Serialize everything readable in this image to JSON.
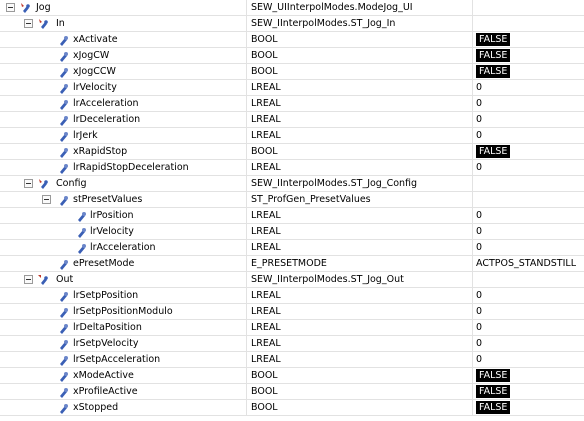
{
  "rows": [
    {
      "name": "Jog",
      "type": "SEW_UIInterpolModes.ModeJog_UI",
      "value": "",
      "is_bool": false,
      "expanded": true,
      "icon": "struct-variable-icon"
    },
    {
      "name": "In",
      "type": "SEW_IInterpolModes.ST_Jog_In",
      "value": "",
      "is_bool": false,
      "expanded": true,
      "icon": "struct-variable-icon"
    },
    {
      "name": "xActivate",
      "type": "BOOL",
      "value": "FALSE",
      "is_bool": true,
      "icon": "variable-icon"
    },
    {
      "name": "xJogCW",
      "type": "BOOL",
      "value": "FALSE",
      "is_bool": true,
      "icon": "variable-icon"
    },
    {
      "name": "xJogCCW",
      "type": "BOOL",
      "value": "FALSE",
      "is_bool": true,
      "icon": "variable-icon"
    },
    {
      "name": "lrVelocity",
      "type": "LREAL",
      "value": "0",
      "is_bool": false,
      "icon": "variable-icon"
    },
    {
      "name": "lrAcceleration",
      "type": "LREAL",
      "value": "0",
      "is_bool": false,
      "icon": "variable-icon"
    },
    {
      "name": "lrDeceleration",
      "type": "LREAL",
      "value": "0",
      "is_bool": false,
      "icon": "variable-icon"
    },
    {
      "name": "lrJerk",
      "type": "LREAL",
      "value": "0",
      "is_bool": false,
      "icon": "variable-icon"
    },
    {
      "name": "xRapidStop",
      "type": "BOOL",
      "value": "FALSE",
      "is_bool": true,
      "icon": "variable-icon"
    },
    {
      "name": "lrRapidStopDeceleration",
      "type": "LREAL",
      "value": "0",
      "is_bool": false,
      "icon": "variable-icon"
    },
    {
      "name": "Config",
      "type": "SEW_IInterpolModes.ST_Jog_Config",
      "value": "",
      "is_bool": false,
      "expanded": true,
      "icon": "struct-variable-icon"
    },
    {
      "name": "stPresetValues",
      "type": "ST_ProfGen_PresetValues",
      "value": "",
      "is_bool": false,
      "expanded": true,
      "icon": "variable-icon"
    },
    {
      "name": "lrPosition",
      "type": "LREAL",
      "value": "0",
      "is_bool": false,
      "icon": "variable-icon"
    },
    {
      "name": "lrVelocity",
      "type": "LREAL",
      "value": "0",
      "is_bool": false,
      "icon": "variable-icon"
    },
    {
      "name": "lrAcceleration",
      "type": "LREAL",
      "value": "0",
      "is_bool": false,
      "icon": "variable-icon"
    },
    {
      "name": "ePresetMode",
      "type": "E_PRESETMODE",
      "value": "ACTPOS_STANDSTILL",
      "is_bool": false,
      "icon": "variable-icon"
    },
    {
      "name": "Out",
      "type": "SEW_IInterpolModes.ST_Jog_Out",
      "value": "",
      "is_bool": false,
      "expanded": true,
      "icon": "output-struct-icon"
    },
    {
      "name": "lrSetpPosition",
      "type": "LREAL",
      "value": "0",
      "is_bool": false,
      "icon": "variable-icon"
    },
    {
      "name": "lrSetpPositionModulo",
      "type": "LREAL",
      "value": "0",
      "is_bool": false,
      "icon": "variable-icon"
    },
    {
      "name": "lrDeltaPosition",
      "type": "LREAL",
      "value": "0",
      "is_bool": false,
      "icon": "variable-icon"
    },
    {
      "name": "lrSetpVelocity",
      "type": "LREAL",
      "value": "0",
      "is_bool": false,
      "icon": "variable-icon"
    },
    {
      "name": "lrSetpAcceleration",
      "type": "LREAL",
      "value": "0",
      "is_bool": false,
      "icon": "variable-icon"
    },
    {
      "name": "xModeActive",
      "type": "BOOL",
      "value": "FALSE",
      "is_bool": true,
      "icon": "variable-icon"
    },
    {
      "name": "xProfileActive",
      "type": "BOOL",
      "value": "FALSE",
      "is_bool": true,
      "icon": "variable-icon"
    },
    {
      "name": "xStopped",
      "type": "BOOL",
      "value": "FALSE",
      "is_bool": true,
      "icon": "variable-icon"
    }
  ],
  "colors": {
    "bool_badge_bg": "#000000",
    "bool_badge_fg": "#ffffff",
    "icon_blue": "#3a5fb5",
    "icon_red": "#c0392b"
  }
}
